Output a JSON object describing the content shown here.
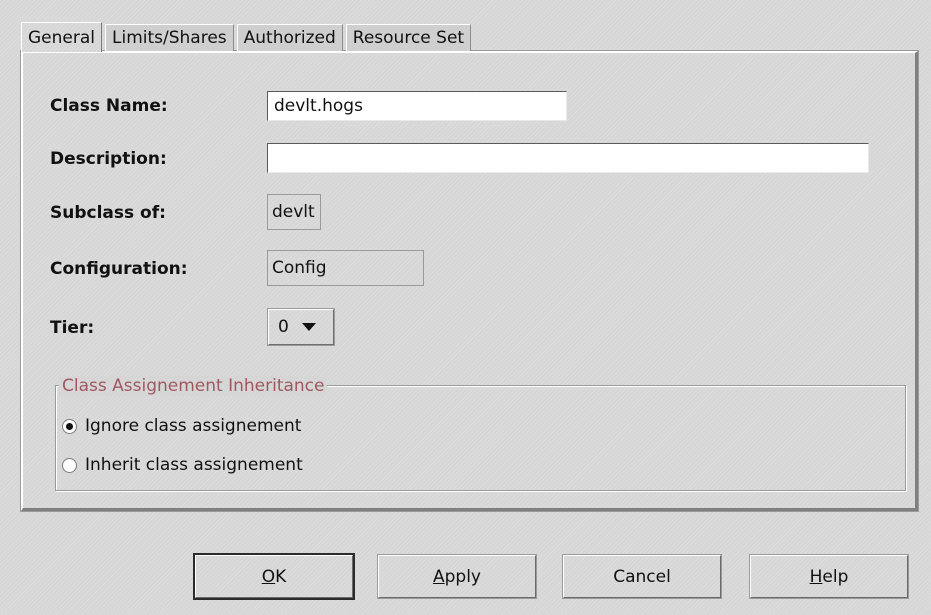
{
  "tabs": [
    {
      "label": "General",
      "active": true
    },
    {
      "label": "Limits/Shares",
      "active": false
    },
    {
      "label": "Authorized",
      "active": false
    },
    {
      "label": "Resource Set",
      "active": false
    }
  ],
  "form": {
    "class_name_label": "Class Name:",
    "class_name_value": "devlt.hogs",
    "description_label": "Description:",
    "description_value": "",
    "subclass_label": "Subclass of:",
    "subclass_value": "devlt",
    "configuration_label": "Configuration:",
    "configuration_value": "Config",
    "tier_label": "Tier:",
    "tier_value": "0"
  },
  "inheritance": {
    "title": "Class Assignement Inheritance",
    "options": [
      {
        "label": "Ignore class assignement",
        "checked": true
      },
      {
        "label": "Inherit class assignement",
        "checked": false
      }
    ]
  },
  "buttons": {
    "ok": {
      "mnemonic": "O",
      "rest": "K"
    },
    "apply": {
      "mnemonic": "A",
      "rest": "pply"
    },
    "cancel": {
      "label": "Cancel"
    },
    "help": {
      "mnemonic": "H",
      "rest": "elp"
    }
  },
  "colors": {
    "background": "#d6d6d6",
    "group_title": "#a0585f"
  },
  "icons": {
    "tier_dropdown": "triangle-down-icon"
  }
}
